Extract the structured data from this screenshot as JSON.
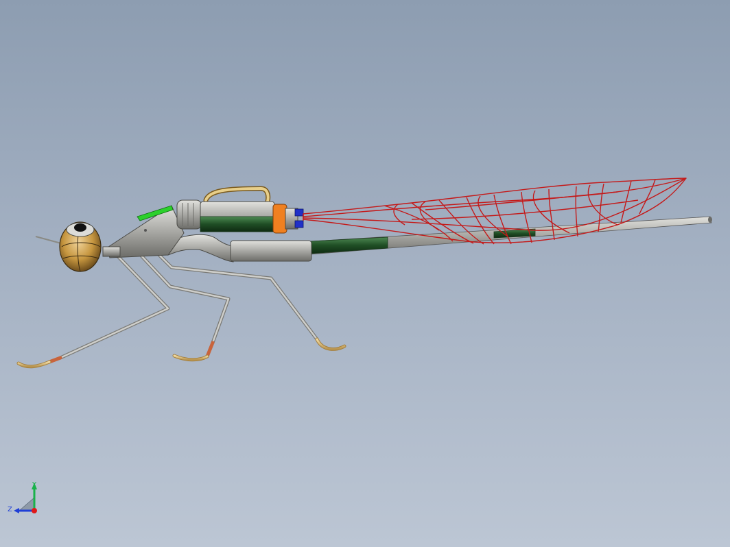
{
  "viewport": {
    "background_top": "#8d9db1",
    "background_bottom": "#bcc6d4",
    "model_name": "dragonfly-assembly"
  },
  "triad": {
    "y_label": "Y",
    "z_label": "Z",
    "colors": {
      "y": "#19b24a",
      "z": "#1f3fd6",
      "x": "#e01818"
    }
  },
  "colors": {
    "wing": "#c41a1a",
    "leg": "#9a9a98",
    "foot": "#e3c98a",
    "joint": "#c8643c",
    "body_green": "#25572c",
    "body_gray": "#b8b8b4",
    "accent_orange": "#f08020",
    "accent_blue": "#2030c8",
    "accent_bright_green": "#2cd02c",
    "eye": "#c99a4a"
  }
}
